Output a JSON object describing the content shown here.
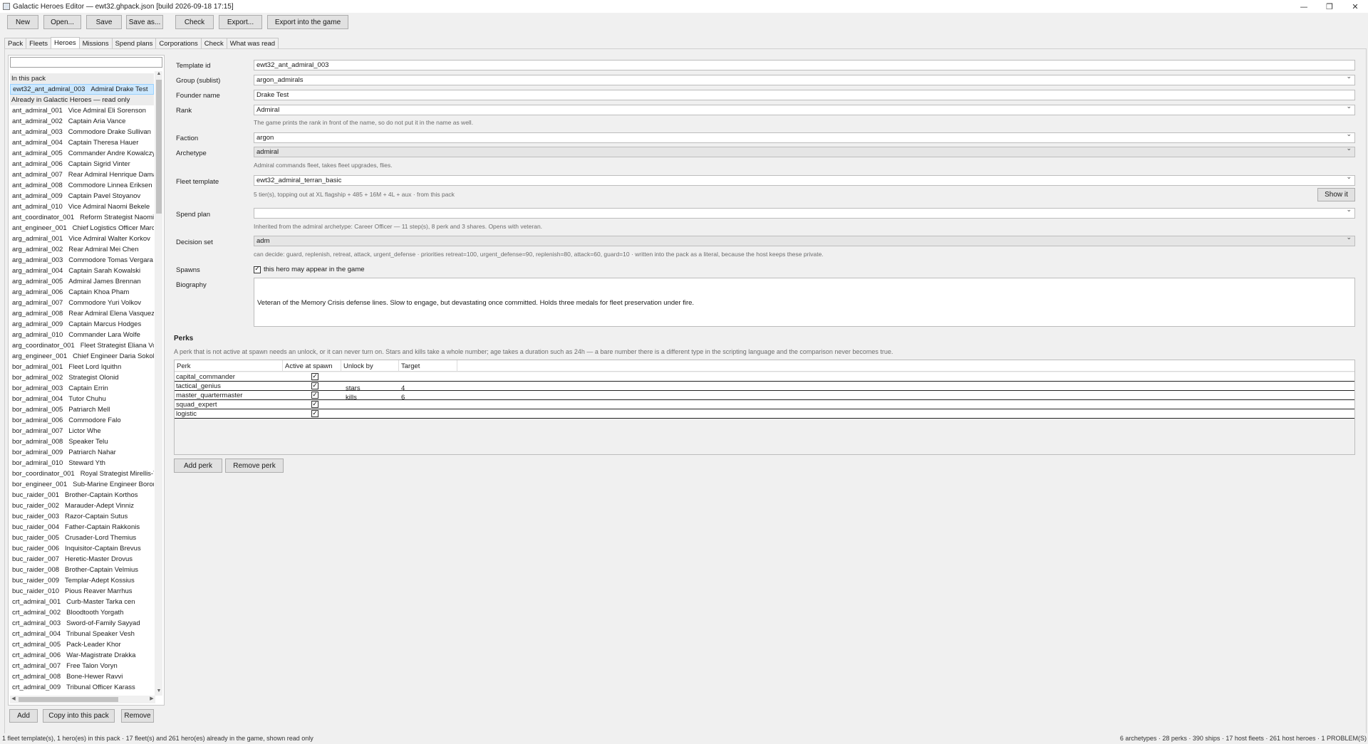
{
  "window": {
    "title": "Galactic Heroes Editor — ewt32.ghpack.json   [build 2026-09-18 17:15]",
    "minimize": "—",
    "maximize": "❐",
    "close": "✕"
  },
  "toolbar": {
    "new": "New",
    "open": "Open...",
    "save": "Save",
    "save_as": "Save as...",
    "check": "Check",
    "export": "Export...",
    "export_game": "Export into the game"
  },
  "tabs": [
    "Pack",
    "Fleets",
    "Heroes",
    "Missions",
    "Spend plans",
    "Corporations",
    "Check",
    "What was read"
  ],
  "active_tab": "Heroes",
  "hero_list": {
    "search_value": "",
    "pack_header": "In this pack",
    "pack_items": [
      {
        "id": "ewt32_ant_admiral_003",
        "name": "Admiral Drake Test"
      }
    ],
    "game_header": "Already in Galactic Heroes — read only",
    "game_items": [
      {
        "id": "ant_admiral_001",
        "name": "Vice Admiral Eli Sorenson"
      },
      {
        "id": "ant_admiral_002",
        "name": "Captain Aria Vance"
      },
      {
        "id": "ant_admiral_003",
        "name": "Commodore Drake Sullivan"
      },
      {
        "id": "ant_admiral_004",
        "name": "Captain Theresa Hauer"
      },
      {
        "id": "ant_admiral_005",
        "name": "Commander Andre Kowalczyk"
      },
      {
        "id": "ant_admiral_006",
        "name": "Captain Sigrid Vinter"
      },
      {
        "id": "ant_admiral_007",
        "name": "Rear Admiral Henrique Damasceno"
      },
      {
        "id": "ant_admiral_008",
        "name": "Commodore Linnea Eriksen"
      },
      {
        "id": "ant_admiral_009",
        "name": "Captain Pavel Stoyanov"
      },
      {
        "id": "ant_admiral_010",
        "name": "Vice Admiral Naomi Bekele"
      },
      {
        "id": "ant_coordinator_001",
        "name": "Reform Strategist Naomi Sato"
      },
      {
        "id": "ant_engineer_001",
        "name": "Chief Logistics Officer Marcus"
      },
      {
        "id": "arg_admiral_001",
        "name": "Vice Admiral Walter Korkov"
      },
      {
        "id": "arg_admiral_002",
        "name": "Rear Admiral Mei Chen"
      },
      {
        "id": "arg_admiral_003",
        "name": "Commodore Tomas Vergara"
      },
      {
        "id": "arg_admiral_004",
        "name": "Captain Sarah Kowalski"
      },
      {
        "id": "arg_admiral_005",
        "name": "Admiral James Brennan"
      },
      {
        "id": "arg_admiral_006",
        "name": "Captain Khoa Pham"
      },
      {
        "id": "arg_admiral_007",
        "name": "Commodore Yuri Volkov"
      },
      {
        "id": "arg_admiral_008",
        "name": "Rear Admiral Elena Vasquez"
      },
      {
        "id": "arg_admiral_009",
        "name": "Captain Marcus Hodges"
      },
      {
        "id": "arg_admiral_010",
        "name": "Commander Lara Wolfe"
      },
      {
        "id": "arg_coordinator_001",
        "name": "Fleet Strategist Eliana Voss"
      },
      {
        "id": "arg_engineer_001",
        "name": "Chief Engineer Daria Sokolova"
      },
      {
        "id": "bor_admiral_001",
        "name": "Fleet Lord Iquithn"
      },
      {
        "id": "bor_admiral_002",
        "name": "Strategist Olonid"
      },
      {
        "id": "bor_admiral_003",
        "name": "Captain Errin"
      },
      {
        "id": "bor_admiral_004",
        "name": "Tutor Chuhu"
      },
      {
        "id": "bor_admiral_005",
        "name": "Patriarch Mell"
      },
      {
        "id": "bor_admiral_006",
        "name": "Commodore Falo"
      },
      {
        "id": "bor_admiral_007",
        "name": "Lictor Whe"
      },
      {
        "id": "bor_admiral_008",
        "name": "Speaker Telu"
      },
      {
        "id": "bor_admiral_009",
        "name": "Patriarch Nahar"
      },
      {
        "id": "bor_admiral_010",
        "name": "Steward Yth"
      },
      {
        "id": "bor_coordinator_001",
        "name": "Royal Strategist Mirellis-Tha"
      },
      {
        "id": "bor_engineer_001",
        "name": "Sub-Marine Engineer Boronis"
      },
      {
        "id": "buc_raider_001",
        "name": "Brother-Captain Korthos"
      },
      {
        "id": "buc_raider_002",
        "name": "Marauder-Adept Vinniz"
      },
      {
        "id": "buc_raider_003",
        "name": "Razor-Captain Sutus"
      },
      {
        "id": "buc_raider_004",
        "name": "Father-Captain Rakkonis"
      },
      {
        "id": "buc_raider_005",
        "name": "Crusader-Lord Themius"
      },
      {
        "id": "buc_raider_006",
        "name": "Inquisitor-Captain Brevus"
      },
      {
        "id": "buc_raider_007",
        "name": "Heretic-Master Drovus"
      },
      {
        "id": "buc_raider_008",
        "name": "Brother-Captain Velmius"
      },
      {
        "id": "buc_raider_009",
        "name": "Templar-Adept Kossius"
      },
      {
        "id": "buc_raider_010",
        "name": "Pious Reaver Marrhus"
      },
      {
        "id": "crt_admiral_001",
        "name": "Curb-Master Tarka cen"
      },
      {
        "id": "crt_admiral_002",
        "name": "Bloodtooth Yorgath"
      },
      {
        "id": "crt_admiral_003",
        "name": "Sword-of-Family Sayyad"
      },
      {
        "id": "crt_admiral_004",
        "name": "Tribunal Speaker Vesh"
      },
      {
        "id": "crt_admiral_005",
        "name": "Pack-Leader Khor"
      },
      {
        "id": "crt_admiral_006",
        "name": "War-Magistrate Drakka"
      },
      {
        "id": "crt_admiral_007",
        "name": "Free Talon Voryn"
      },
      {
        "id": "crt_admiral_008",
        "name": "Bone-Hewer Ravvi"
      },
      {
        "id": "crt_admiral_009",
        "name": "Tribunal Officer Karass"
      }
    ],
    "add": "Add",
    "copy": "Copy into this pack",
    "remove": "Remove"
  },
  "form": {
    "template_id": {
      "label": "Template id",
      "value": "ewt32_ant_admiral_003"
    },
    "group": {
      "label": "Group (sublist)",
      "value": "argon_admirals"
    },
    "founder": {
      "label": "Founder name",
      "value": "Drake Test"
    },
    "rank": {
      "label": "Rank",
      "value": "Admiral",
      "hint": "The game prints the rank in front of the name, so do not put it in the name as well."
    },
    "faction": {
      "label": "Faction",
      "value": "argon"
    },
    "archetype": {
      "label": "Archetype",
      "value": "admiral",
      "hint": "Admiral commands fleet, takes fleet upgrades, flies."
    },
    "fleet_template": {
      "label": "Fleet template",
      "value": "ewt32_admiral_terran_basic",
      "hint": "5 tier(s), topping out at XL flagship + 485 + 16M + 4L + aux  ·  from this pack",
      "show_it": "Show it"
    },
    "spend_plan": {
      "label": "Spend plan",
      "value": "",
      "hint": "Inherited from the admiral archetype: Career Officer — 11 step(s), 8 perk and 3 shares. Opens with veteran."
    },
    "decision_set": {
      "label": "Decision set",
      "value": "adm",
      "hint": "can decide: guard, replenish, retreat, attack, urgent_defense   ·   priorities retreat=100, urgent_defense=90, replenish=80, attack=60, guard=10   ·   written into the pack as a literal, because the host keeps these private."
    },
    "spawns": {
      "label": "Spawns",
      "check": "✓",
      "text": "this hero may appear in the game"
    },
    "biography": {
      "label": "Biography",
      "value": "Veteran of the Memory Crisis defense lines. Slow to engage, but devastating once committed. Holds three medals for fleet preservation under fire."
    }
  },
  "perks": {
    "heading": "Perks",
    "hint": "A perk that is not active at spawn needs an unlock, or it can never turn on. Stars and kills take a whole number; age takes a duration such as 24h — a bare number there is a different type in the scripting language and the comparison never becomes true.",
    "columns": [
      "Perk",
      "Active at spawn",
      "Unlock by",
      "Target"
    ],
    "check": "✓",
    "rows": [
      {
        "perk": "capital_commander",
        "active": true,
        "unlock": "",
        "target": ""
      },
      {
        "perk": "tactical_genius",
        "active": true,
        "unlock": "stars",
        "target": "4"
      },
      {
        "perk": "master_quartermaster",
        "active": true,
        "unlock": "kills",
        "target": "6"
      },
      {
        "perk": "squad_expert",
        "active": true,
        "unlock": "",
        "target": ""
      },
      {
        "perk": "logistic",
        "active": true,
        "unlock": "",
        "target": ""
      }
    ],
    "add": "Add perk",
    "remove": "Remove perk"
  },
  "status": {
    "left": "1 fleet template(s), 1 hero(es) in this pack · 17 fleet(s) and 261 hero(es) already in the game, shown read only",
    "right": "6 archetypes · 28 perks · 390 ships · 17 host fleets · 261 host heroes  ·  1 PROBLEM(S)"
  }
}
